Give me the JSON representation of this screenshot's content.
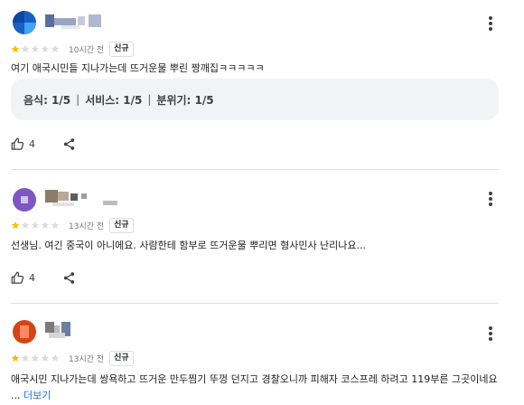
{
  "reviews": [
    {
      "rating": 1,
      "max_rating": 5,
      "time": "10시간 전",
      "badge": "신규",
      "text": "여기 애국시민들 지나가는데 뜨거운물 뿌린 짱깨집ㅋㅋㅋㅋㅋ",
      "ratings": {
        "food": "음식: 1/5",
        "service": "서비스: 1/5",
        "atmosphere": "분위기: 1/5"
      },
      "likes": "4",
      "avatar_color": "#1a5fc4"
    },
    {
      "rating": 1,
      "max_rating": 5,
      "time": "13시간 전",
      "badge": "신규",
      "text": "선생님. 여긴 중국이 아니에요. 사람한테 함부로 뜨거운물 뿌리면 형사민사 난리나요...",
      "likes": "4",
      "avatar_color": "#7e57c2"
    },
    {
      "rating": 1,
      "max_rating": 5,
      "time": "13시간 전",
      "badge": "신규",
      "text": "애국시민 지나가는데 쌍욕하고 뜨거운 만두찜기 뚜껑 던지고 경찰오니까 피해자 코스프레 하려고 119부른 그곳이네요 ...",
      "more": "더보기",
      "avatar_color": "#d84315"
    }
  ],
  "colors": {
    "star_filled": "#fbbc04",
    "star_empty": "#dadce0",
    "link": "#1a73e8"
  },
  "icons": {
    "more": "kebab-icon",
    "like": "thumbs-up-icon",
    "share": "share-icon",
    "star": "star-icon"
  }
}
